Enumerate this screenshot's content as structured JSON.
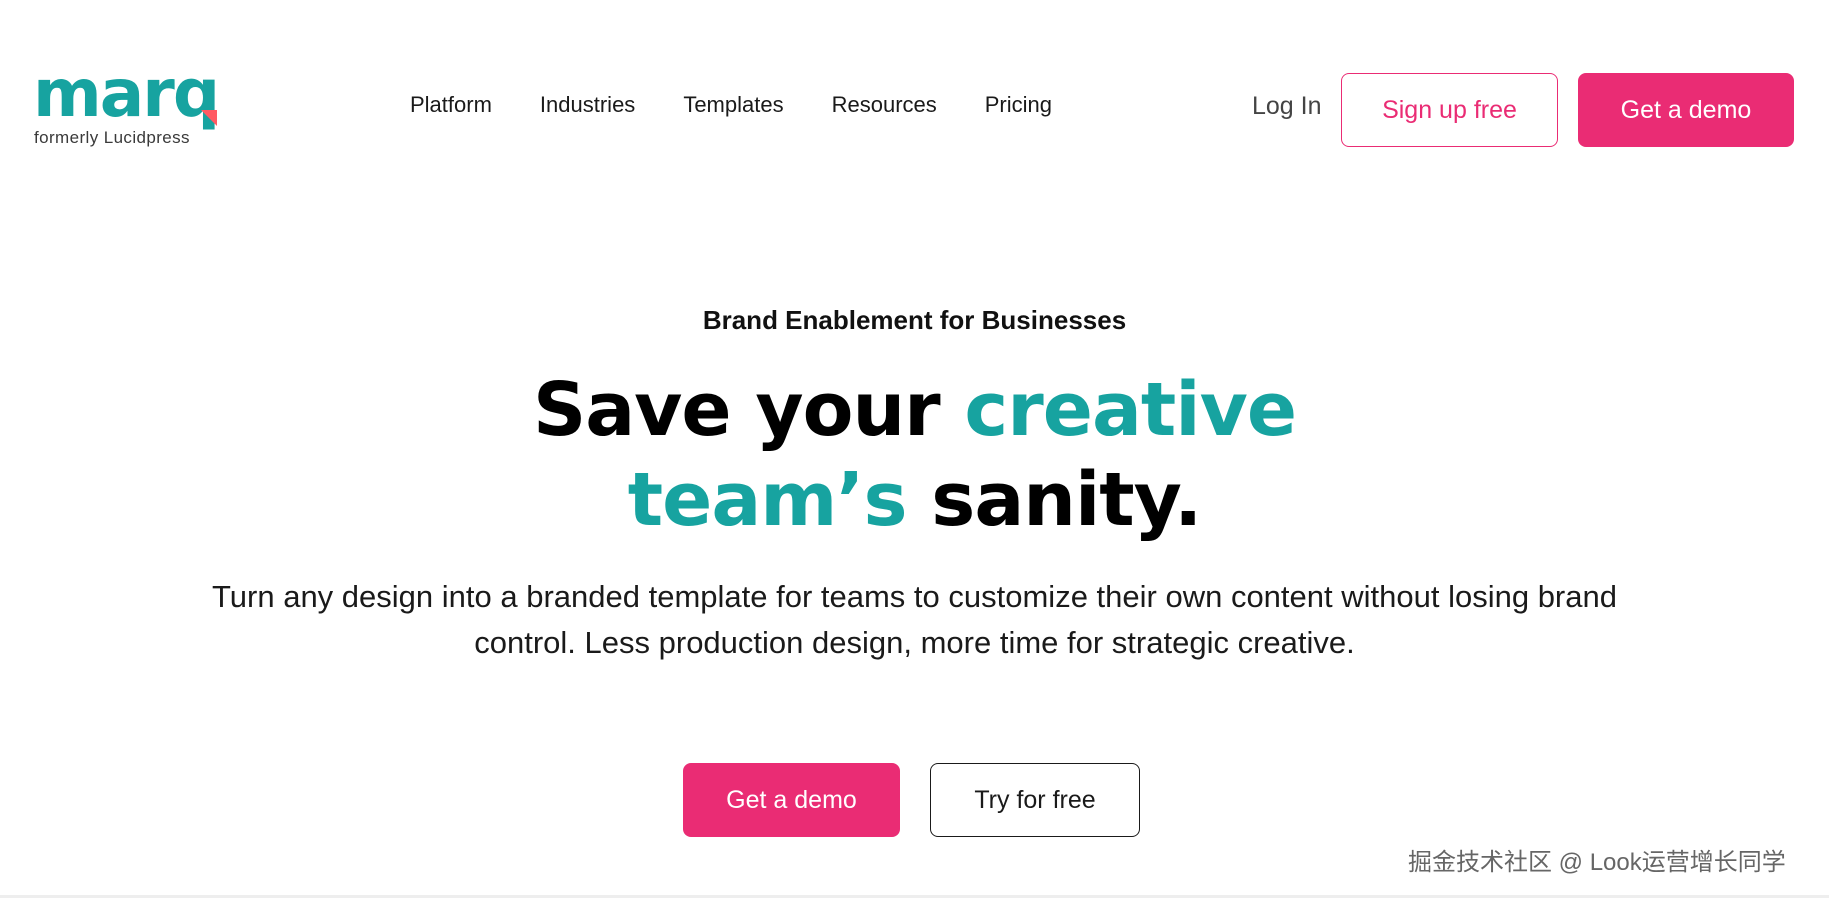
{
  "brand": {
    "logo_text": "marq",
    "tagline": "formerly Lucidpress",
    "teal": "#17a3a0",
    "pink": "#ea2c74",
    "accent_mark": "#ff5a63"
  },
  "nav": {
    "items": [
      {
        "label": "Platform"
      },
      {
        "label": "Industries"
      },
      {
        "label": "Templates"
      },
      {
        "label": "Resources"
      },
      {
        "label": "Pricing"
      }
    ],
    "login_label": "Log In",
    "signup_label": "Sign up free",
    "demo_label": "Get a demo"
  },
  "hero": {
    "eyebrow": "Brand Enablement for Businesses",
    "headline_part1": "Save your ",
    "headline_part2": "creative",
    "headline_part3": "team’s",
    "headline_part4": " sanity.",
    "subtext": "Turn any design into a branded template for teams to customize their own content without losing brand control. Less production design, more time for strategic creative.",
    "primary_cta": "Get a demo",
    "secondary_cta": "Try for free"
  },
  "watermark": {
    "text": "掘金技术社区 @ Look运营增长同学"
  }
}
